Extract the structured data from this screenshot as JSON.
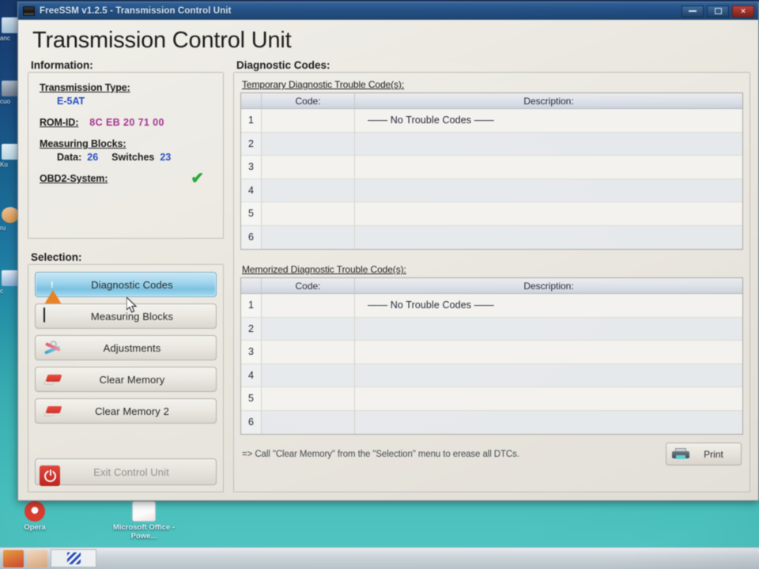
{
  "window": {
    "title": "FreeSSM v1.2.5 - Transmission Control Unit",
    "app_icon": "monitor-icon",
    "controls": {
      "minimize": "minimize-icon",
      "maximize": "maximize-icon",
      "close": "close-icon"
    }
  },
  "page": {
    "heading": "Transmission Control Unit"
  },
  "information": {
    "group_title": "Information:",
    "transmission_type_label": "Transmission Type:",
    "transmission_type_value": "E-5AT",
    "rom_id_label": "ROM-ID:",
    "rom_id_value": "8C EB 20 71 00",
    "measuring_blocks_label": "Measuring Blocks:",
    "data_label": "Data:",
    "data_value": "26",
    "switches_label": "Switches",
    "switches_value": "23",
    "obd2_label": "OBD2-System:",
    "obd2_check": "✔",
    "colors": {
      "value_blue": "#1947c8",
      "value_magenta": "#a62a8f",
      "check_green": "#17a62c"
    }
  },
  "selection": {
    "group_title": "Selection:",
    "buttons": [
      {
        "label": "Diagnostic Codes",
        "icon": "warning-triangle-icon",
        "active": true
      },
      {
        "label": "Measuring Blocks",
        "icon": "monitor-graph-icon",
        "active": false
      },
      {
        "label": "Adjustments",
        "icon": "tools-icon",
        "active": false
      },
      {
        "label": "Clear Memory",
        "icon": "eraser-icon",
        "active": false
      },
      {
        "label": "Clear Memory 2",
        "icon": "eraser-icon",
        "active": false
      }
    ],
    "exit_button": {
      "label": "Exit Control Unit",
      "icon": "power-icon"
    },
    "active_color": "#74c3e6"
  },
  "diagnostic_codes": {
    "group_title": "Diagnostic Codes:",
    "temporary": {
      "caption": "Temporary Diagnostic Trouble Code(s):",
      "columns": [
        "",
        "Code:",
        "Description:"
      ],
      "rows": [
        {
          "index": "1",
          "code": "",
          "description": "—— No Trouble Codes ——"
        },
        {
          "index": "2",
          "code": "",
          "description": ""
        },
        {
          "index": "3",
          "code": "",
          "description": ""
        },
        {
          "index": "4",
          "code": "",
          "description": ""
        },
        {
          "index": "5",
          "code": "",
          "description": ""
        },
        {
          "index": "6",
          "code": "",
          "description": ""
        }
      ]
    },
    "memorized": {
      "caption": "Memorized Diagnostic Trouble Code(s):",
      "columns": [
        "",
        "Code:",
        "Description:"
      ],
      "rows": [
        {
          "index": "1",
          "code": "",
          "description": "—— No Trouble Codes ——"
        },
        {
          "index": "2",
          "code": "",
          "description": ""
        },
        {
          "index": "3",
          "code": "",
          "description": ""
        },
        {
          "index": "4",
          "code": "",
          "description": ""
        },
        {
          "index": "5",
          "code": "",
          "description": ""
        },
        {
          "index": "6",
          "code": "",
          "description": ""
        }
      ]
    },
    "hint": "=> Call \"Clear Memory\" from the \"Selection\" menu to erease all DTCs.",
    "print_button": "Print"
  },
  "desktop": {
    "icons": [
      {
        "label": "Opera",
        "icon": "opera-icon"
      },
      {
        "label": "Microsoft Office - Powe...",
        "icon": "powerpoint-icon"
      }
    ]
  }
}
